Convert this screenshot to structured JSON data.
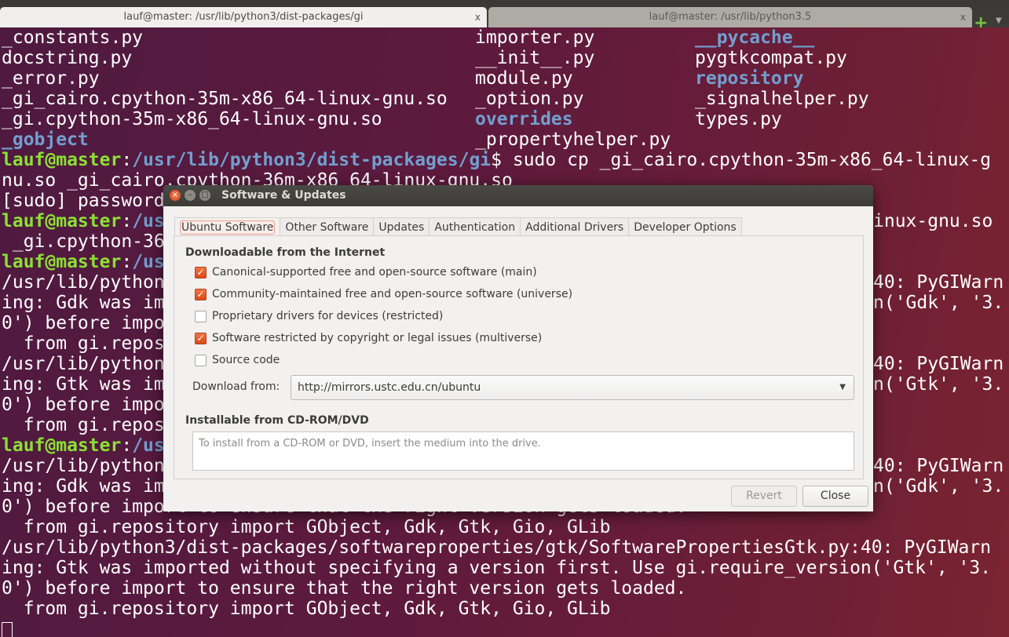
{
  "tabs": [
    {
      "title": "lauf@master: /usr/lib/python3/dist-packages/gi",
      "close": "x",
      "active": true
    },
    {
      "title": "lauf@master: /usr/lib/python3.5",
      "close": "x",
      "active": false
    }
  ],
  "new_tab_icon": "plus-icon",
  "terminal": {
    "ls": [
      [
        {
          "t": "_constants.py"
        },
        {
          "t": "importer.py"
        },
        {
          "t": "__pycache__",
          "dir": true
        }
      ],
      [
        {
          "t": "docstring.py"
        },
        {
          "t": "__init__.py"
        },
        {
          "t": "pygtkcompat.py"
        }
      ],
      [
        {
          "t": "_error.py"
        },
        {
          "t": "module.py"
        },
        {
          "t": "repository",
          "dir": true
        }
      ],
      [
        {
          "t": "_gi_cairo.cpython-35m-x86_64-linux-gnu.so"
        },
        {
          "t": "_option.py"
        },
        {
          "t": "_signalhelper.py"
        }
      ],
      [
        {
          "t": "_gi.cpython-35m-x86_64-linux-gnu.so"
        },
        {
          "t": "overrides",
          "dir": true
        },
        {
          "t": "types.py"
        }
      ],
      [
        {
          "t": "_gobject",
          "dir": true
        },
        {
          "t": "_propertyhelper.py"
        },
        {
          "t": ""
        }
      ]
    ],
    "lines": [
      {
        "seg": [
          {
            "t": "lauf@master",
            "s": "usr"
          },
          {
            "t": ":"
          },
          {
            "t": "/usr/lib/python3/dist-packages/gi",
            "s": "path"
          },
          {
            "t": "$ sudo cp _gi_cairo.cpython-35m-x86_64-linux-g"
          }
        ]
      },
      {
        "seg": [
          {
            "t": "nu.so _gi_cairo.cpython-36m-x86_64-linux-gnu.so"
          }
        ]
      },
      {
        "seg": [
          {
            "t": "[sudo] password"
          }
        ]
      },
      {
        "seg": [
          {
            "t": "lauf@master",
            "s": "usr"
          },
          {
            "t": ":"
          },
          {
            "t": "/us",
            "s": "path"
          }
        ],
        "right": "inux-gnu.so"
      },
      {
        "seg": [
          {
            "t": " _gi.cpython-36"
          }
        ]
      },
      {
        "seg": [
          {
            "t": "lauf@master",
            "s": "usr"
          },
          {
            "t": ":"
          },
          {
            "t": "/us",
            "s": "path"
          }
        ]
      },
      {
        "seg": [
          {
            "t": "/usr/lib/python"
          }
        ],
        "right": "40: PyGIWarn"
      },
      {
        "seg": [
          {
            "t": "ing: Gdk was im"
          }
        ],
        "right": "n('Gdk', '3."
      },
      {
        "seg": [
          {
            "t": "0') before impo"
          }
        ]
      },
      {
        "seg": [
          {
            "t": "  from gi.repos"
          }
        ]
      },
      {
        "seg": [
          {
            "t": "/usr/lib/python"
          }
        ],
        "right": "40: PyGIWarn"
      },
      {
        "seg": [
          {
            "t": "ing: Gtk was im"
          }
        ],
        "right": "n('Gtk', '3."
      },
      {
        "seg": [
          {
            "t": "0') before impo"
          }
        ]
      },
      {
        "seg": [
          {
            "t": "  from gi.repos"
          }
        ]
      },
      {
        "seg": [
          {
            "t": "lauf@master",
            "s": "usr"
          },
          {
            "t": ":"
          },
          {
            "t": "/us",
            "s": "path"
          }
        ]
      },
      {
        "seg": [
          {
            "t": "/usr/lib/python"
          }
        ],
        "right": "40: PyGIWarn"
      },
      {
        "seg": [
          {
            "t": "ing: Gdk was im"
          }
        ],
        "right": "n('Gdk', '3."
      },
      {
        "seg": [
          {
            "t": "0') before import to ensure that the right version gets loaded."
          }
        ]
      },
      {
        "seg": [
          {
            "t": "  from gi.repository import GObject, Gdk, Gtk, Gio, GLib"
          }
        ]
      },
      {
        "seg": [
          {
            "t": "/usr/lib/python3/dist-packages/softwareproperties/gtk/SoftwarePropertiesGtk.py:40: PyGIWarn"
          }
        ]
      },
      {
        "seg": [
          {
            "t": "ing: Gtk was imported without specifying a version first. Use gi.require_version('Gtk', '3."
          }
        ]
      },
      {
        "seg": [
          {
            "t": "0') before import to ensure that the right version gets loaded."
          }
        ]
      },
      {
        "seg": [
          {
            "t": "  from gi.repository import GObject, Gdk, Gtk, Gio, GLib"
          }
        ]
      }
    ]
  },
  "dialog": {
    "title": "Software & Updates",
    "window_buttons": {
      "close": "×",
      "minimize": "–",
      "maximize": "□"
    },
    "tabs": [
      "Ubuntu Software",
      "Other Software",
      "Updates",
      "Authentication",
      "Additional Drivers",
      "Developer Options"
    ],
    "active_tab": "Ubuntu Software",
    "section_internet": "Downloadable from the Internet",
    "checkboxes": [
      {
        "label": "Canonical-supported free and open-source software (main)",
        "checked": true
      },
      {
        "label": "Community-maintained free and open-source software (universe)",
        "checked": true
      },
      {
        "label": "Proprietary drivers for devices (restricted)",
        "checked": false
      },
      {
        "label": "Software restricted by copyright or legal issues (multiverse)",
        "checked": true
      },
      {
        "label": "Source code",
        "checked": false
      }
    ],
    "download_from_label": "Download from:",
    "download_from_value": "http://mirrors.ustc.edu.cn/ubuntu",
    "section_cdrom": "Installable from CD-ROM/DVD",
    "cdrom_text": "To install from a CD-ROM or DVD, insert the medium into the drive.",
    "revert_label": "Revert",
    "close_label": "Close"
  },
  "colors": {
    "accent": "#dd4814",
    "user": "#8ae234",
    "path": "#729fcf"
  }
}
